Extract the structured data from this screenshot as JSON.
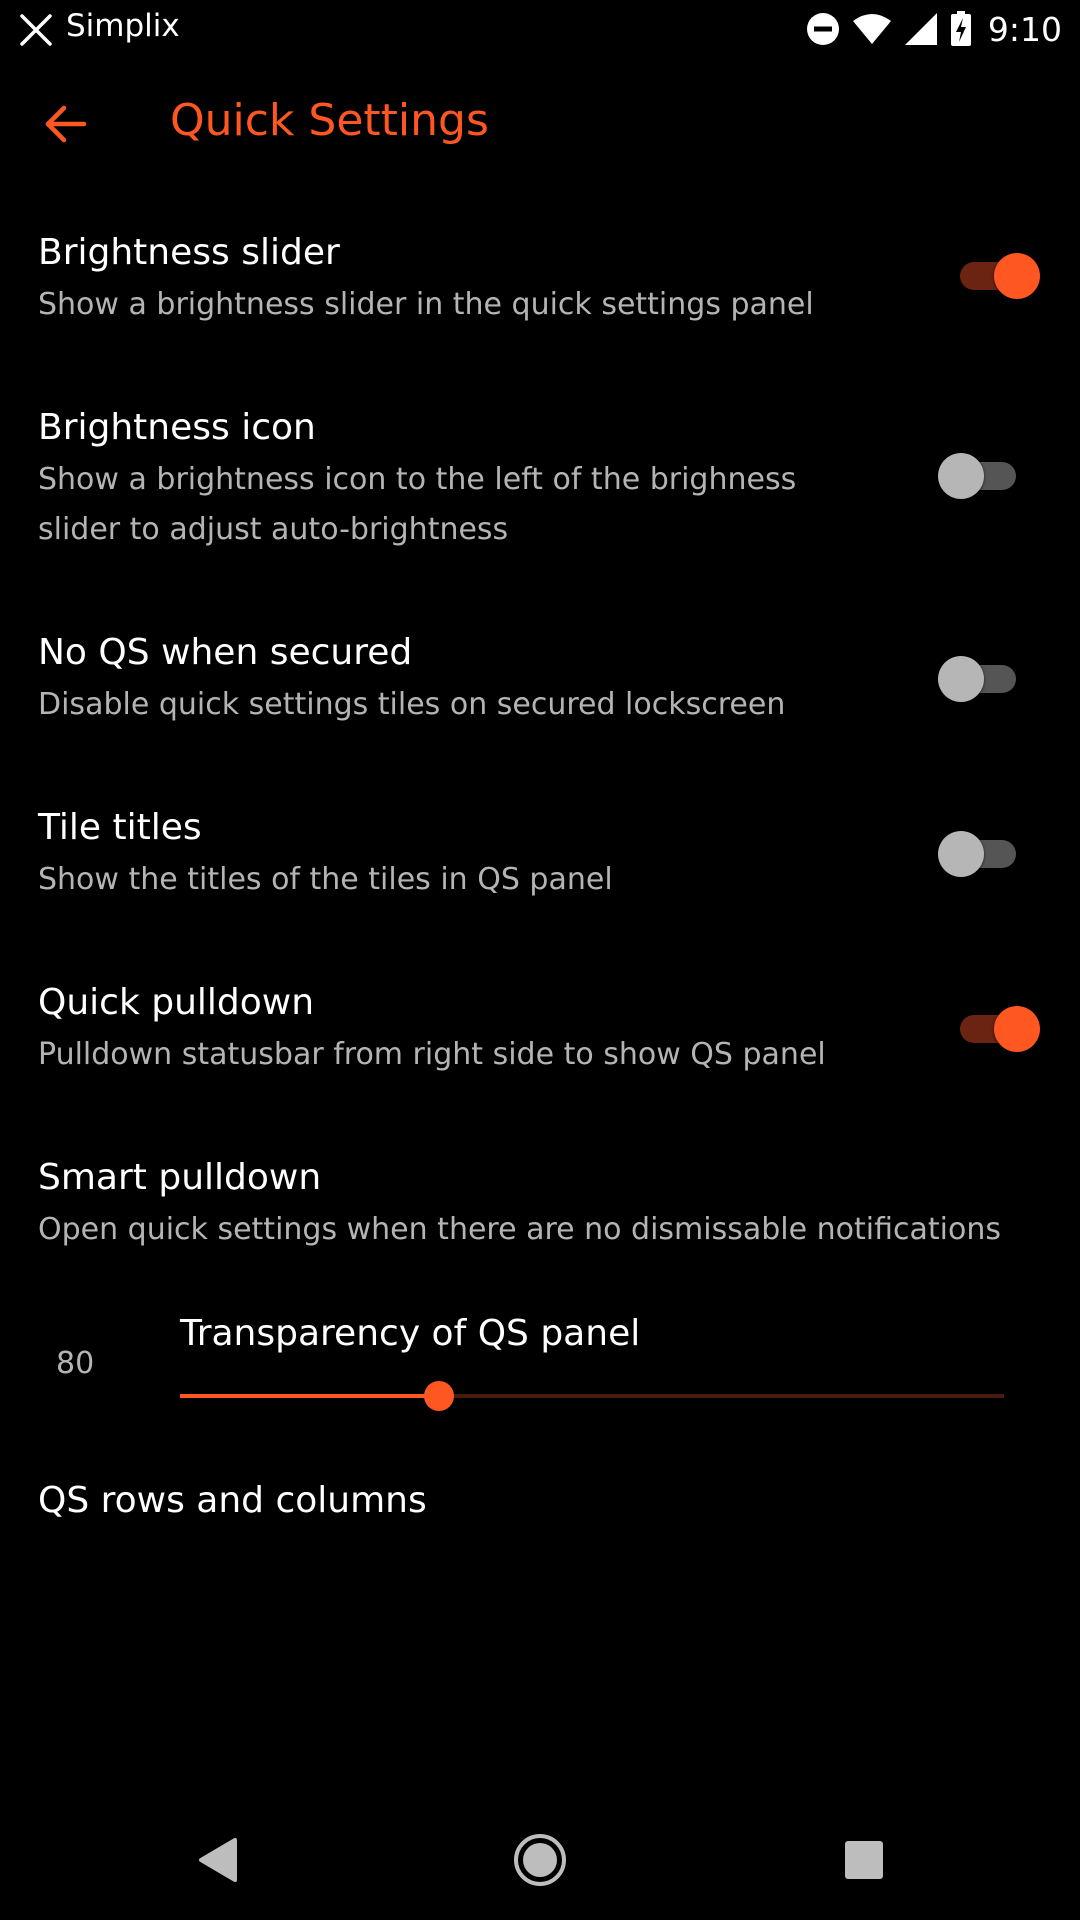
{
  "status_bar": {
    "app_name": "Simplix",
    "time": "9:10",
    "icons": [
      "close-icon",
      "do-not-disturb-icon",
      "wifi-icon",
      "signal-icon",
      "battery-charging-icon"
    ]
  },
  "header": {
    "title": "Quick Settings",
    "back_icon": "arrow-back-icon"
  },
  "settings": [
    {
      "title": "Brightness slider",
      "summary": "Show a brightness slider in the quick settings panel",
      "toggle": true
    },
    {
      "title": "Brightness icon",
      "summary": "Show a brightness icon to the left of the brighness slider to adjust auto-brightness",
      "toggle": false
    },
    {
      "title": "No QS when secured",
      "summary": "Disable quick settings tiles on secured lockscreen",
      "toggle": false
    },
    {
      "title": "Tile titles",
      "summary": "Show the titles of the tiles in QS panel",
      "toggle": false
    },
    {
      "title": "Quick pulldown",
      "summary": "Pulldown statusbar from right side to show QS panel",
      "toggle": true
    },
    {
      "title": "Smart pulldown",
      "summary": "Open quick settings when there are no dismissable notifications"
    }
  ],
  "transparency": {
    "title": "Transparency of QS panel",
    "value": "80",
    "fraction": 0.314
  },
  "rows_columns": {
    "title": "QS rows and columns"
  },
  "nav": {
    "back_icon": "nav-back-icon",
    "home_icon": "nav-home-icon",
    "recents_icon": "nav-recents-icon"
  },
  "colors": {
    "accent": "#ff5722",
    "background": "#000000",
    "summary_text": "#b4b4b4"
  }
}
